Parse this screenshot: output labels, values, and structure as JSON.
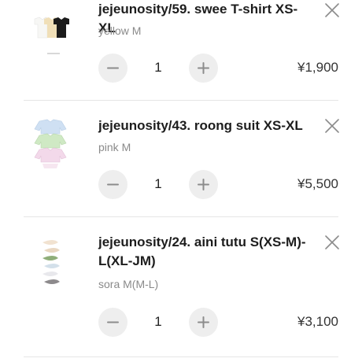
{
  "cart": {
    "items": [
      {
        "title": "jejeunosity/59. swee T-shirt XS-XL",
        "variant": "yellow M",
        "quantity": "1",
        "price": "¥1,900",
        "thumbnail": "tshirt-trio-image"
      },
      {
        "title": "jejeunosity/43. roong suit XS-XL",
        "variant": "pink M",
        "quantity": "1",
        "price": "¥5,500",
        "thumbnail": "suit-stack-image"
      },
      {
        "title": "jejeunosity/24. aini tutu S(XS-M)-L(XL-JM)",
        "variant": "sora M(M-L)",
        "quantity": "1",
        "price": "¥3,100",
        "thumbnail": "tutu-stack-image"
      }
    ],
    "icons": {
      "remove": "close-icon",
      "decrement": "minus-icon",
      "increment": "plus-icon"
    },
    "colors": {
      "stepper_bg": "#eeeeee",
      "icon": "#8c8c8c",
      "divider": "#e6e6e6"
    }
  }
}
